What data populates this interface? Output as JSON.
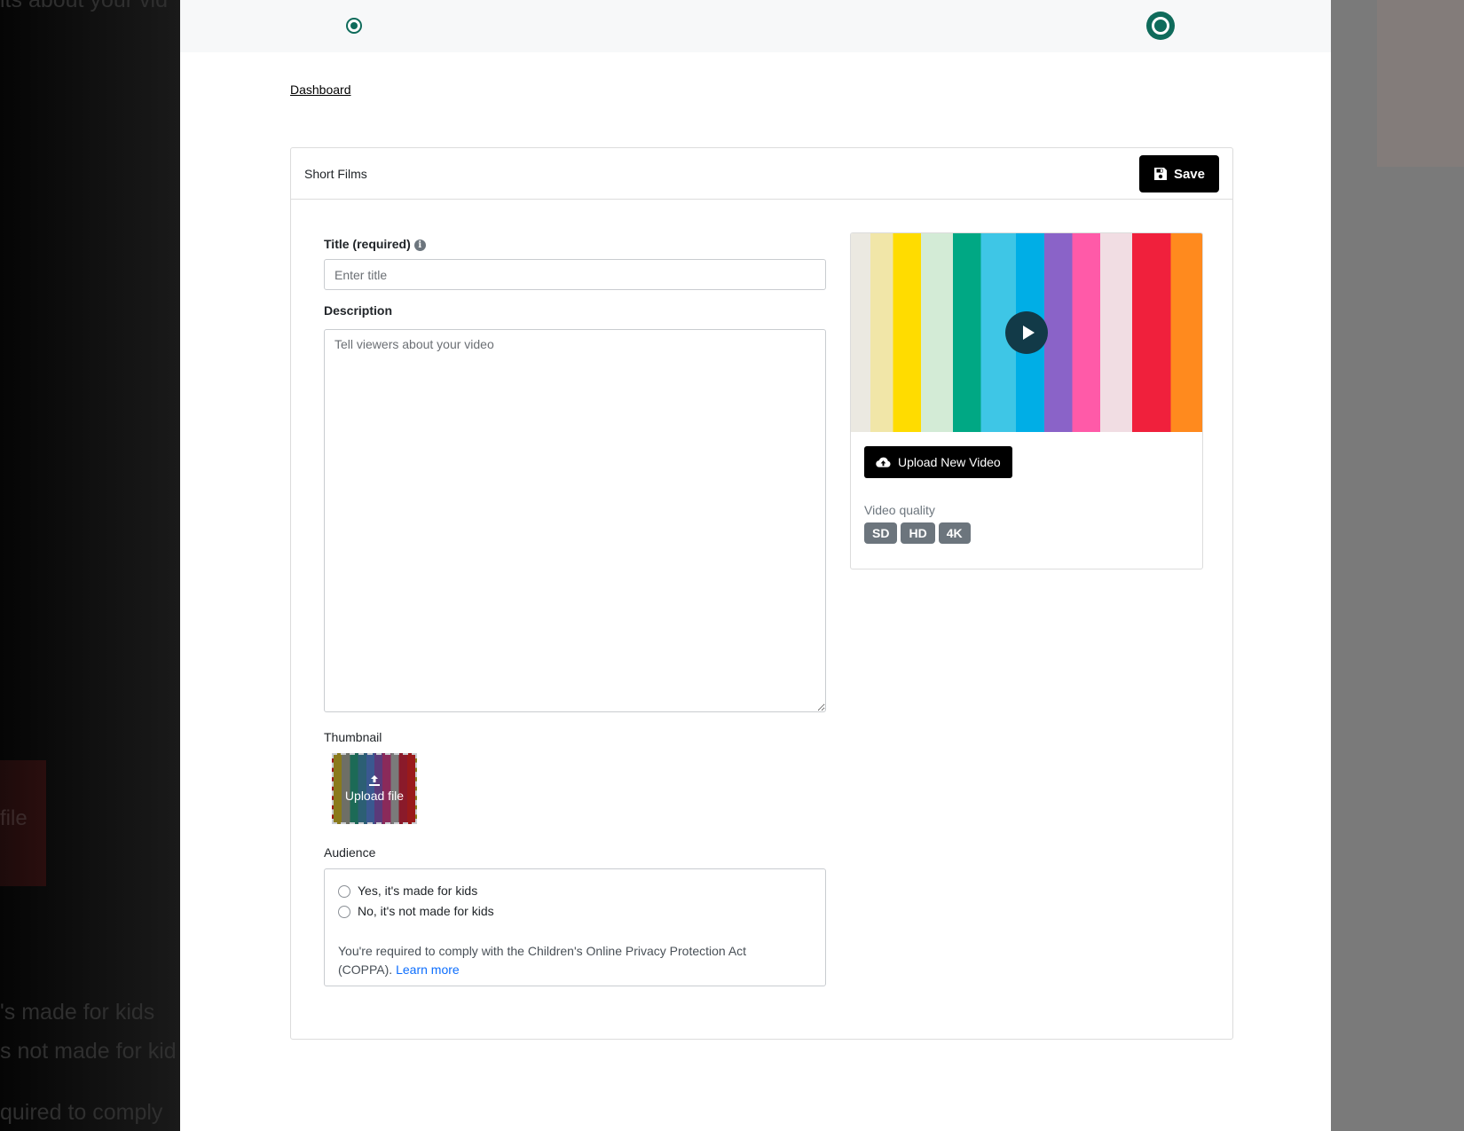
{
  "background_page": {
    "ghost_text_top": "its about your vid",
    "ghost_text_kids_yes": "'s made for kids",
    "ghost_text_kids_no": "s not made for kid",
    "ghost_text_coppa": "quired to comply",
    "ghost_thumb_label": "file"
  },
  "nav": {
    "breadcrumb": "Dashboard"
  },
  "card": {
    "title": "Short Films",
    "save_label": "Save"
  },
  "form": {
    "title_label": "Title (required)",
    "title_info_icon": "info-icon",
    "title_placeholder": "Enter title",
    "title_value": "",
    "description_label": "Description",
    "description_placeholder": "Tell viewers about your video",
    "description_value": "",
    "thumbnail_label": "Thumbnail",
    "thumbnail_upload_label": "Upload file",
    "audience_label": "Audience",
    "audience_options": [
      "Yes, it's made for kids",
      "No, it's not made for kids"
    ],
    "coppa_text": "You're required to comply with the Children's Online Privacy Protection Act (COPPA).",
    "coppa_link": "Learn more"
  },
  "video": {
    "upload_label": "Upload New Video",
    "quality_label": "Video quality",
    "qualities": [
      "SD",
      "HD",
      "4K"
    ]
  },
  "colors": {
    "accent": "#0f6b5b",
    "primary_button": "#000000",
    "badge": "#6c757d",
    "link": "#0d6efd"
  }
}
